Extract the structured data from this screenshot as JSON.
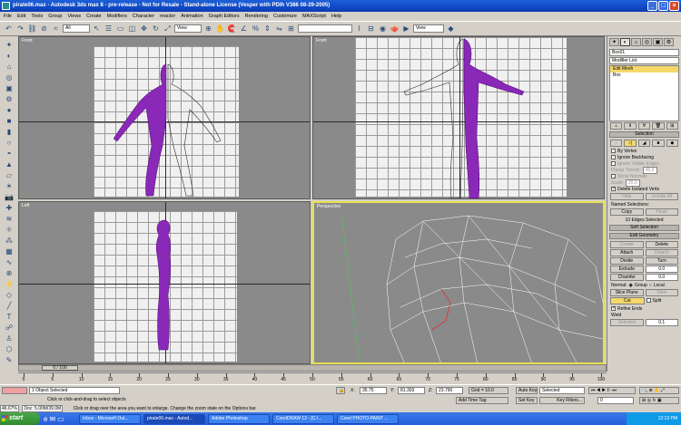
{
  "window": {
    "title": "pirate06.max - Autodesk 3ds max 8 - pre-release - Not for Resale - Stand-alone License (Vesper with PDIh V386 08-29-2005)"
  },
  "menu": [
    "File",
    "Edit",
    "Tools",
    "Group",
    "Views",
    "Create",
    "Modifiers",
    "Character",
    "reactor",
    "Animation",
    "Graph Editors",
    "Rendering",
    "Customize",
    "MAXScript",
    "Help"
  ],
  "toolbar": {
    "selection_filter": "All",
    "ref_coord": "View",
    "ref_coord2": "View"
  },
  "viewports": {
    "top": "Front",
    "left": "Left",
    "topleft": "Front",
    "persp": "Perspective"
  },
  "cmd_panel": {
    "object_name": "Box01",
    "modifier_list": "Modifier List",
    "stack": [
      "Edit Mesh",
      "Box"
    ],
    "selection": {
      "header": "Selection",
      "by_vertex": "By Vertex",
      "ignore_backfacing": "Ignore Backfacing",
      "ignore_visible": "Ignore Visible Edges",
      "planar_thresh": "Planar Thresh:",
      "planar_val": "45.0",
      "show_normals": "Show Normals",
      "scale": "Scale:",
      "scale_val": "20.0",
      "delete_isolated": "Delete Isolated Verts",
      "hide": "Hide",
      "unhide_all": "Unhide All",
      "named_sel": "Named Selections:",
      "copy": "Copy",
      "paste": "Paste",
      "count": "10 Edges Selected"
    },
    "soft_selection": "Soft Selection",
    "edit_geometry": {
      "header": "Edit Geometry",
      "create": "Create",
      "delete": "Delete",
      "attach": "Attach",
      "detach": "Detach",
      "divide": "Divide",
      "turn": "Turn",
      "extrude": "Extrude",
      "extrude_val": "0.0",
      "chamfer": "Chamfer",
      "chamfer_val": "0.0",
      "normal": "Normal:",
      "group": "Group",
      "local": "Local",
      "slice_plane": "Slice Plane",
      "slice": "Slice",
      "cut": "Cut",
      "split": "Split",
      "refine_ends": "Refine Ends",
      "weld": "Weld",
      "selected": "Selected",
      "weld_val": "0.1"
    }
  },
  "timeline": {
    "frame": "0 / 100",
    "ticks": [
      "0",
      "5",
      "10",
      "15",
      "20",
      "25",
      "30",
      "35",
      "40",
      "45",
      "50",
      "55",
      "60",
      "65",
      "70",
      "75",
      "80",
      "85",
      "90",
      "95",
      "100"
    ]
  },
  "status": {
    "selected": "1 Object Selected",
    "prompt": "Click or click-and-drag to select objects",
    "x": "35.75",
    "y": "81.303",
    "z": "23.790",
    "grid": "Grid = 10.0",
    "add_time_tag": "Add Time Tag",
    "auto_key": "Auto Key",
    "set_key": "Set Key",
    "key_mode": "Selected",
    "key_filters": "Key Filters...",
    "frame_field": "0",
    "mem": "46.67%",
    "doc": "Doc: 5.00M/39.0M",
    "hint": "Click or drag over the area you want to enlarge. Change the zoom state on the Options bar."
  },
  "taskbar": {
    "start": "start",
    "tasks": [
      "Inbox - Microsoft Out...",
      "pirate06.max - Autod...",
      "Adobe Photoshop",
      "CorelDRAW 12 - [C:\\...",
      "Corel PHOTO-PAINT ..."
    ],
    "clock": "12:13 PM"
  }
}
